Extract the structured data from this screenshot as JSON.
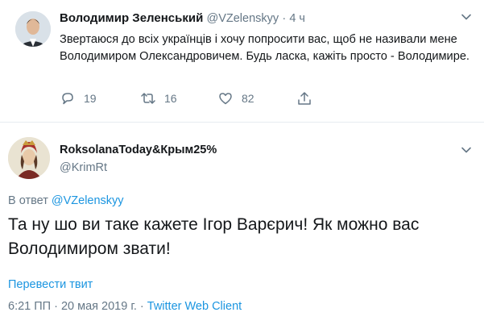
{
  "tweet": {
    "author_name": "Володимир Зеленський",
    "author_handle": "@VZelenskyy",
    "separator": "·",
    "time": "4 ч",
    "text": "Звертаюся до всіх українців і хочу попросити вас, щоб не називали мене Володимиром Олександровичем. Будь ласка, кажіть просто - Володимире.",
    "replies": "19",
    "retweets": "16",
    "likes": "82"
  },
  "reply": {
    "author_name": "RoksolanaToday&Крым25%",
    "author_handle": "@KrimRt",
    "reply_prefix": "В ответ",
    "reply_to": "@VZelenskyy",
    "text": "Та ну шо ви таке кажете Ігор Варєрич! Як можно вас Володимиром звати!",
    "translate_label": "Перевести твит",
    "timestamp": "6:21 ПП · 20 мая 2019 г. · ",
    "source": "Twitter Web Client"
  },
  "icons": {
    "reply": "reply-icon",
    "retweet": "retweet-icon",
    "like": "heart-icon",
    "share": "share-icon",
    "menu": "chevron-down-icon"
  },
  "colors": {
    "link": "#1b95e0",
    "muted": "#657786",
    "text": "#14171a",
    "divider": "#e6ecf0"
  }
}
